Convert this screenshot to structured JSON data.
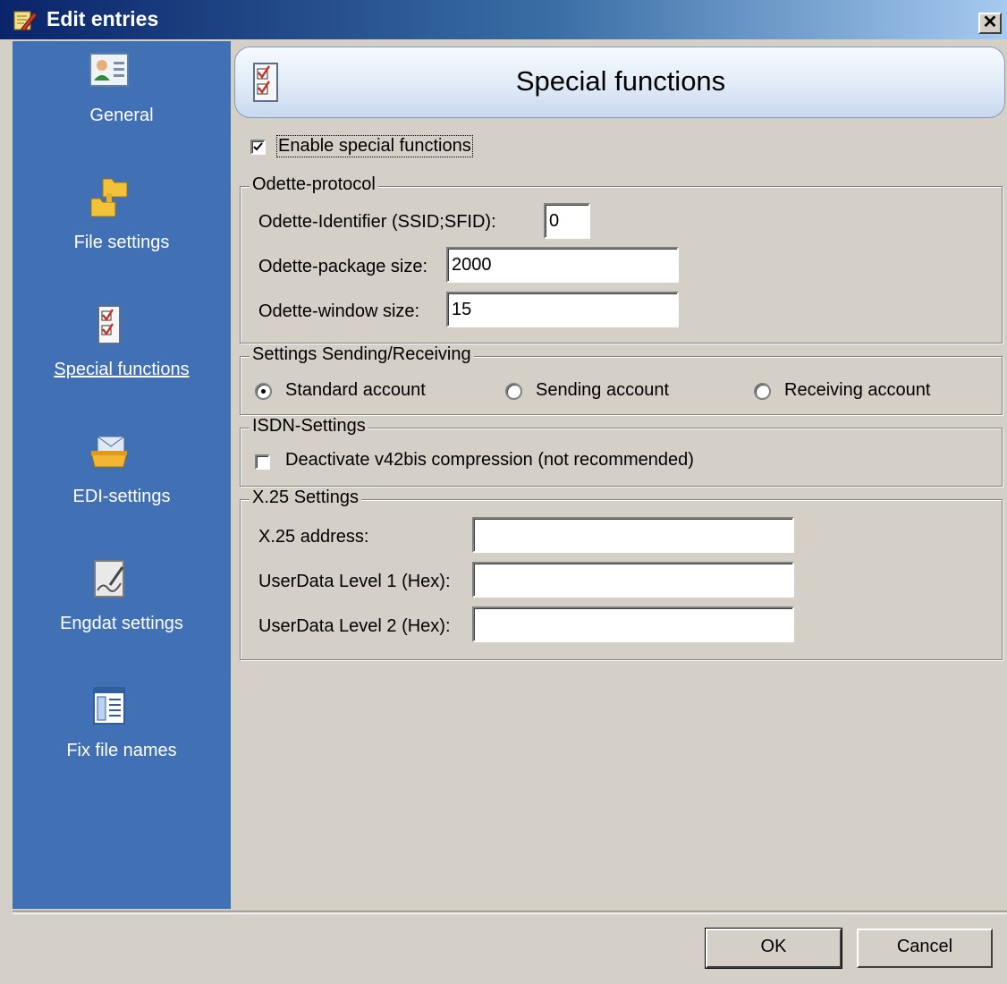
{
  "window": {
    "title": "Edit entries",
    "close_glyph": "✕"
  },
  "sidebar": {
    "items": [
      {
        "label": "General",
        "icon": "user-card-icon"
      },
      {
        "label": "File settings",
        "icon": "folders-icon"
      },
      {
        "label": "Special functions",
        "icon": "checklist-icon"
      },
      {
        "label": "EDI-settings",
        "icon": "mail-tray-icon"
      },
      {
        "label": "Engdat settings",
        "icon": "document-sign-icon"
      },
      {
        "label": "Fix file names",
        "icon": "table-list-icon"
      }
    ],
    "active": "Special functions"
  },
  "header": {
    "title": "Special functions",
    "icon": "checklist-icon"
  },
  "enable_special": {
    "label": "Enable special functions",
    "checked": true
  },
  "odette": {
    "title": "Odette-protocol",
    "identifier_label": "Odette-Identifier (SSID;SFID):",
    "identifier_value": "0",
    "package_label": "Odette-package size:",
    "package_value": "2000",
    "window_label": "Odette-window size:",
    "window_value": "15"
  },
  "sending": {
    "title": "Settings Sending/Receiving",
    "options": [
      "Standard account",
      "Sending account",
      "Receiving account"
    ],
    "selected": "Standard account"
  },
  "isdn": {
    "title": "ISDN-Settings",
    "deactivate_label": "Deactivate v42bis compression (not recommended)",
    "checked": false
  },
  "x25": {
    "title": "X.25 Settings",
    "address_label": "X.25 address:",
    "address_value": "",
    "ud1_label": "UserData Level 1 (Hex):",
    "ud1_value": "",
    "ud2_label": "UserData Level 2 (Hex):",
    "ud2_value": ""
  },
  "footer": {
    "ok_label": "OK",
    "cancel_label": "Cancel"
  }
}
